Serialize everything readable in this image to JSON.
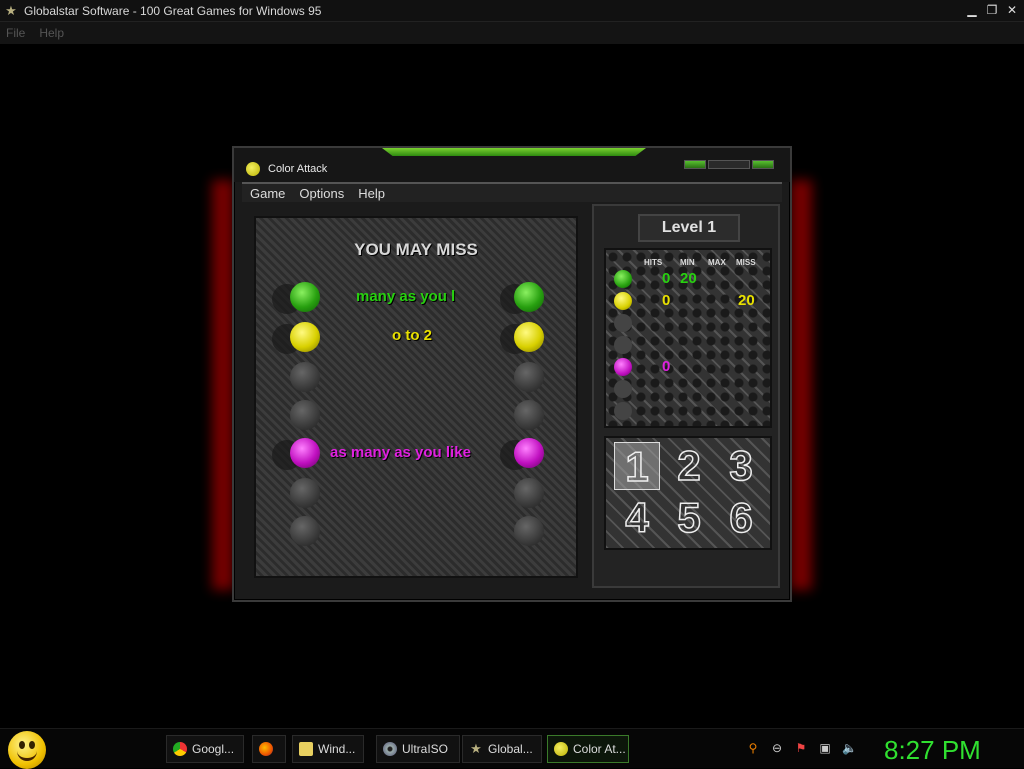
{
  "window": {
    "title": "Globalstar Software - 100 Great Games for Windows 95",
    "menu": [
      "File",
      "Help"
    ]
  },
  "game": {
    "title": "Color Attack",
    "menu": [
      "Game",
      "Options",
      "Help"
    ],
    "board": {
      "heading": "YOU MAY MISS",
      "rows": [
        {
          "color": "green",
          "text": "many as you l"
        },
        {
          "color": "yellow",
          "text": "o to 2"
        },
        {
          "color": "gray",
          "text": ""
        },
        {
          "color": "gray",
          "text": ""
        },
        {
          "color": "purple",
          "text": "as many as you like"
        },
        {
          "color": "gray",
          "text": ""
        },
        {
          "color": "gray",
          "text": ""
        }
      ]
    },
    "level": "Level 1",
    "stats": {
      "headers": [
        "HITS",
        "MIN",
        "MAX",
        "MISS"
      ],
      "green": {
        "hits": "0",
        "min": "20"
      },
      "yellow": {
        "hits": "0",
        "miss": "20"
      },
      "purple": {
        "hits": "0"
      }
    },
    "levels": [
      "1",
      "2",
      "3",
      "4",
      "5",
      "6"
    ],
    "selected_level": "1"
  },
  "taskbar": {
    "tasks": [
      {
        "label": "Googl...",
        "icon": "chrome-icon"
      },
      {
        "label": "",
        "icon": "firefox-icon"
      },
      {
        "label": "Wind...",
        "icon": "folder-icon"
      },
      {
        "label": "UltraISO",
        "icon": "disc-icon"
      },
      {
        "label": "Global...",
        "icon": "star-icon"
      },
      {
        "label": "Color At...",
        "icon": "color-attack-icon"
      }
    ],
    "clock": "8:27 PM"
  },
  "colors": {
    "green": "#28d010",
    "yellow": "#e8e000",
    "purple": "#e020e0",
    "clock": "#30e030"
  }
}
